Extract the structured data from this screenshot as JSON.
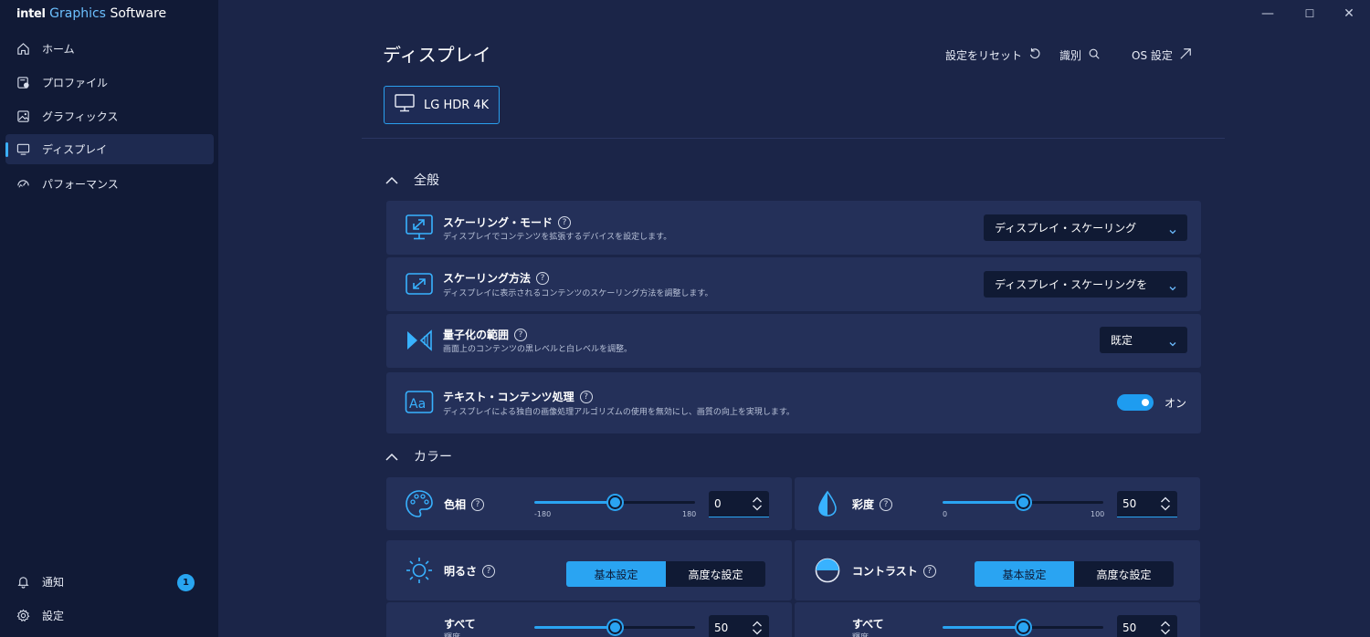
{
  "app": {
    "brand_intel": "intel",
    "brand_graphics": "Graphics",
    "brand_software": "Software"
  },
  "window": {
    "minimize": "—",
    "maximize": "☐",
    "close": "✕"
  },
  "sidebar": {
    "items": [
      {
        "label": "ホーム",
        "icon": "home-icon"
      },
      {
        "label": "プロファイル",
        "icon": "profile-icon"
      },
      {
        "label": "グラフィックス",
        "icon": "image-icon"
      },
      {
        "label": "ディスプレイ",
        "icon": "monitor-icon"
      },
      {
        "label": "パフォーマンス",
        "icon": "performance-icon"
      }
    ],
    "notifications": {
      "label": "通知",
      "count": "1"
    },
    "settings": {
      "label": "設定"
    }
  },
  "header": {
    "title": "ディスプレイ",
    "reset_label": "設定をリセット",
    "identify_label": "識別",
    "os_settings_label": "OS 設定",
    "monitor_name": "LG HDR 4K"
  },
  "sections": {
    "general": "全般",
    "color": "カラー"
  },
  "settings": [
    {
      "title": "スケーリング・モード",
      "desc": "ディスプレイでコンテンツを拡張するデバイスを設定します。",
      "value": "ディスプレイ・スケーリング"
    },
    {
      "title": "スケーリング方法",
      "desc": "ディスプレイに表示されるコンテンツのスケーリング方法を調整します。",
      "value": "ディスプレイ・スケーリングを"
    },
    {
      "title": "量子化の範囲",
      "desc": "画面上のコンテンツの黒レベルと白レベルを調整。",
      "value": "既定"
    },
    {
      "title": "テキスト・コンテンツ処理",
      "desc": "ディスプレイによる独自の画像処理アルゴリズムの使用を無効にし、画質の向上を実現します。",
      "value": "オン"
    }
  ],
  "help_glyph": "?",
  "color": {
    "hue": {
      "label": "色相",
      "min": "-180",
      "max": "180",
      "value": "0",
      "fraction": 0.5
    },
    "saturation": {
      "label": "彩度",
      "min": "0",
      "max": "100",
      "value": "50",
      "fraction": 0.5
    },
    "brightness": {
      "label": "明るさ",
      "basic": "基本設定",
      "advanced": "高度な設定",
      "sub_label": "すべて",
      "sub_desc": "輝度",
      "value": "50",
      "fraction": 0.5
    },
    "contrast": {
      "label": "コントラスト",
      "basic": "基本設定",
      "advanced": "高度な設定",
      "sub_label": "すべて",
      "sub_desc": "輝度",
      "value": "50",
      "fraction": 0.5
    }
  },
  "colors": {
    "accent": "#2aa4f2",
    "background": "#1b2548",
    "sidebar": "#111a36",
    "card": "#243059"
  }
}
